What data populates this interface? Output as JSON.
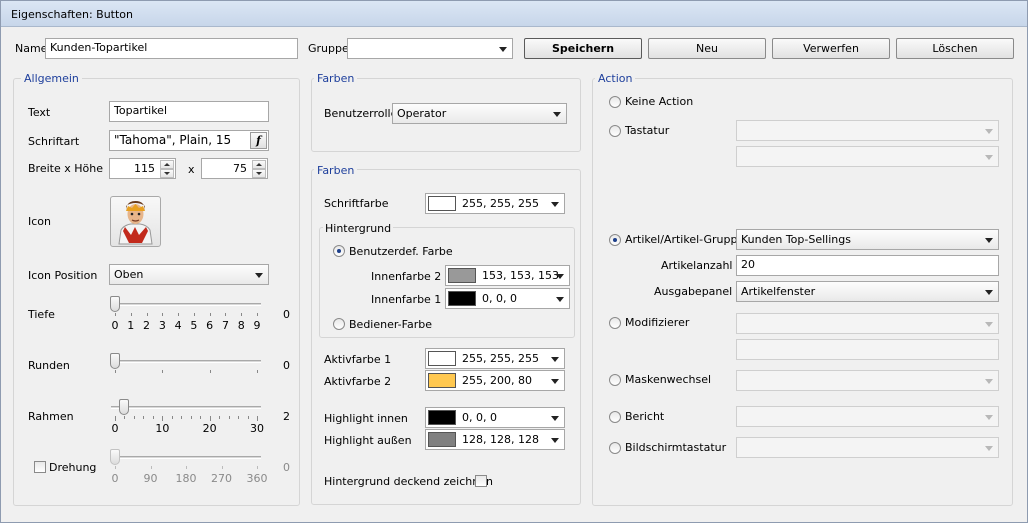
{
  "window": {
    "title": "Eigenschaften: Button"
  },
  "top": {
    "name_label": "Name",
    "name_value": "Kunden-Topartikel",
    "gruppe_label": "Gruppe",
    "gruppe_value": "",
    "buttons": {
      "save": "Speichern",
      "new": "Neu",
      "discard": "Verwerfen",
      "delete": "Löschen"
    }
  },
  "allgemein": {
    "title": "Allgemein",
    "text_label": "Text",
    "text_value": "Topartikel",
    "font_label": "Schriftart",
    "font_value": "\"Tahoma\", Plain, 15",
    "font_button": "f",
    "size_label": "Breite x Höhe",
    "width": "115",
    "x_sep": "x",
    "height": "75",
    "icon_label": "Icon",
    "icon_position_label": "Icon Position",
    "icon_position_value": "Oben",
    "tiefe": {
      "label": "Tiefe",
      "value": "0",
      "level": 0,
      "ticks": [
        "0",
        "1",
        "2",
        "3",
        "4",
        "5",
        "6",
        "7",
        "8",
        "9"
      ]
    },
    "runden": {
      "label": "Runden",
      "value": "0",
      "level": 0
    },
    "rahmen": {
      "label": "Rahmen",
      "value": "2",
      "level": 2,
      "ticks": [
        "0",
        "10",
        "20",
        "30"
      ]
    },
    "drehung": {
      "label": "Drehung",
      "value": "0",
      "level": 0,
      "ticks": [
        "0",
        "90",
        "180",
        "270",
        "360"
      ]
    }
  },
  "farben1": {
    "title": "Farben",
    "role_label": "Benutzerrolle",
    "role_value": "Operator"
  },
  "farben2": {
    "title": "Farben",
    "schriftfarbe_label": "Schriftfarbe",
    "schriftfarbe": {
      "rgb": "255, 255, 255",
      "color": "#ffffff"
    },
    "hintergrund_title": "Hintergrund",
    "benutzerdef_label": "Benutzerdef. Farbe",
    "innenfarbe2_label": "Innenfarbe 2",
    "innenfarbe2": {
      "rgb": "153, 153, 153",
      "color": "#999999"
    },
    "innenfarbe1_label": "Innenfarbe 1",
    "innenfarbe1": {
      "rgb": "0, 0, 0",
      "color": "#000000"
    },
    "bediener_label": "Bediener-Farbe",
    "aktiv1_label": "Aktivfarbe 1",
    "aktiv1": {
      "rgb": "255, 255, 255",
      "color": "#ffffff"
    },
    "aktiv2_label": "Aktivfarbe 2",
    "aktiv2": {
      "rgb": "255, 200, 80",
      "color": "#ffc850"
    },
    "hl_innen_label": "Highlight innen",
    "hl_innen": {
      "rgb": "0, 0, 0",
      "color": "#000000"
    },
    "hl_aussen_label": "Highlight außen",
    "hl_aussen": {
      "rgb": "128, 128, 128",
      "color": "#808080"
    },
    "deckend_label": "Hintergrund deckend zeichnen"
  },
  "action": {
    "title": "Action",
    "keine": "Keine Action",
    "tastatur": "Tastatur",
    "artikel": "Artikel/Artikel-Gruppe",
    "artikel_value": "Kunden Top-Sellings",
    "artikelanzahl_label": "Artikelanzahl",
    "artikelanzahl_value": "20",
    "ausgabepanel_label": "Ausgabepanel",
    "ausgabepanel_value": "Artikelfenster",
    "modifizierer": "Modifizierer",
    "maskenwechsel": "Maskenwechsel",
    "bericht": "Bericht",
    "bildschirmtastatur": "Bildschirmtastatur"
  },
  "icons": {
    "waiter": "person-avatar-icon"
  }
}
